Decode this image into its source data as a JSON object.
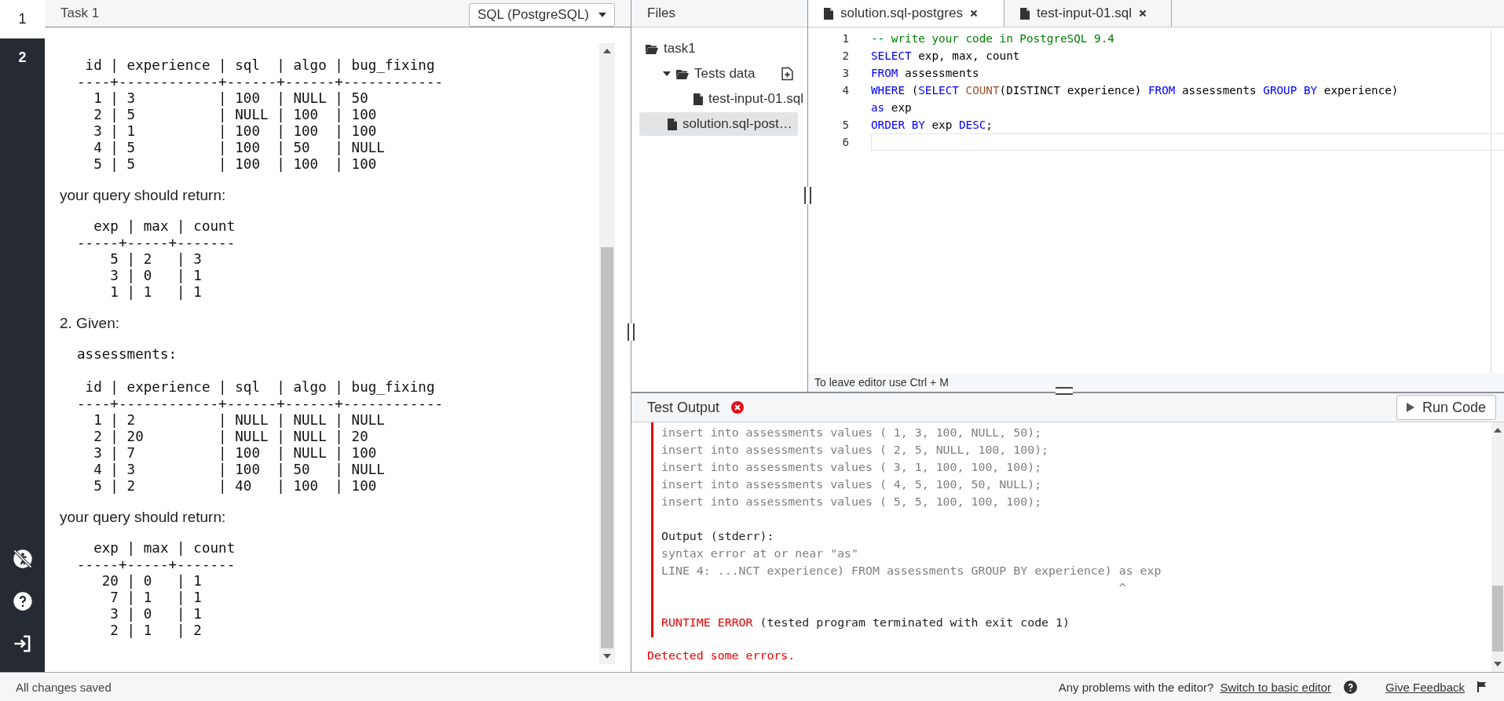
{
  "sidebar": {
    "tasks": [
      {
        "label": "1",
        "selected": true
      },
      {
        "label": "2",
        "selected": false
      }
    ]
  },
  "task_panel": {
    "title": "Task 1",
    "language": "SQL (PostgreSQL)",
    "blocks": [
      {
        "kind": "pre",
        "lines": [
          " id | experience | sql  | algo | bug_fixing",
          "----+------------+------+------+------------",
          "  1 | 3          | 100  | NULL | 50",
          "  2 | 5          | NULL | 100  | 100",
          "  3 | 1          | 100  | 100  | 100",
          "  4 | 5          | 100  | 50   | NULL",
          "  5 | 5          | 100  | 100  | 100"
        ]
      },
      {
        "kind": "text",
        "text": "your query should return:"
      },
      {
        "kind": "pre",
        "lines": [
          "  exp | max | count",
          "-----+-----+-------",
          "    5 | 2   | 3",
          "    3 | 0   | 1",
          "    1 | 1   | 1"
        ]
      },
      {
        "kind": "text",
        "text": "2. Given:"
      },
      {
        "kind": "pre",
        "lines": [
          "assessments:"
        ]
      },
      {
        "kind": "pre",
        "lines": [
          " id | experience | sql  | algo | bug_fixing",
          "----+------------+------+------+------------",
          "  1 | 2          | NULL | NULL | NULL",
          "  2 | 20         | NULL | NULL | 20",
          "  3 | 7          | 100  | NULL | 100",
          "  4 | 3          | 100  | 50   | NULL",
          "  5 | 2          | 40   | 100  | 100"
        ]
      },
      {
        "kind": "text",
        "text": "your query should return:"
      },
      {
        "kind": "pre",
        "lines": [
          "  exp | max | count",
          "-----+-----+-------",
          "   20 | 0   | 1",
          "    7 | 1   | 1",
          "    3 | 0   | 1",
          "    2 | 1   | 2"
        ]
      }
    ]
  },
  "files": {
    "title": "Files",
    "tree": [
      {
        "label": "task1",
        "kind": "folder",
        "expanded": true,
        "selected": false,
        "children": [
          {
            "label": "Tests data",
            "kind": "folder",
            "expanded": true,
            "selected": false,
            "children": [
              {
                "label": "test-input-01.sql",
                "kind": "file",
                "selected": false
              }
            ]
          },
          {
            "label": "solution.sql-post…",
            "kind": "file",
            "selected": true
          }
        ]
      }
    ]
  },
  "editor": {
    "tabs": [
      {
        "label": "solution.sql-postgres",
        "selected": true
      },
      {
        "label": "test-input-01.sql",
        "selected": false
      }
    ],
    "lines": [
      {
        "number": "1",
        "tokens": [
          {
            "kind": "comment",
            "text": "-- write your code in PostgreSQL 9.4"
          }
        ]
      },
      {
        "number": "2",
        "tokens": [
          {
            "kind": "keyword",
            "text": "SELECT"
          },
          {
            "kind": "plain",
            "text": " exp, max, count"
          }
        ]
      },
      {
        "number": "3",
        "tokens": [
          {
            "kind": "keyword",
            "text": "FROM"
          },
          {
            "kind": "plain",
            "text": " assessments"
          }
        ]
      },
      {
        "number": "4",
        "tokens": [
          {
            "kind": "keyword",
            "text": "WHERE"
          },
          {
            "kind": "plain",
            "text": " ("
          },
          {
            "kind": "keyword",
            "text": "SELECT"
          },
          {
            "kind": "function",
            "text": " COUNT"
          },
          {
            "kind": "plain",
            "text": "(DISTINCT experience) "
          },
          {
            "kind": "keyword",
            "text": "FROM"
          },
          {
            "kind": "plain",
            "text": " assessments "
          },
          {
            "kind": "keyword",
            "text": "GROUP BY"
          },
          {
            "kind": "plain",
            "text": " experience) "
          },
          {
            "kind": "keyword",
            "text": "as"
          },
          {
            "kind": "plain",
            "text": " exp"
          }
        ]
      },
      {
        "number": "5",
        "tokens": [
          {
            "kind": "keyword",
            "text": "ORDER BY"
          },
          {
            "kind": "plain",
            "text": " exp "
          },
          {
            "kind": "keyword",
            "text": "DESC"
          },
          {
            "kind": "plain",
            "text": ";"
          }
        ]
      },
      {
        "number": "6",
        "current": true
      }
    ],
    "hint": "To leave editor use Ctrl + M"
  },
  "test_output": {
    "title": "Test Output",
    "has_errors": true,
    "run_button": "Run Code",
    "lines": [
      {
        "kind": "muted",
        "text": "insert into assessments values ( 1, 3, 100, NULL, 50);"
      },
      {
        "kind": "muted",
        "text": "insert into assessments values ( 2, 5, NULL, 100, 100);"
      },
      {
        "kind": "muted",
        "text": "insert into assessments values ( 3, 1, 100, 100, 100);"
      },
      {
        "kind": "muted",
        "text": "insert into assessments values ( 4, 5, 100, 50, NULL);"
      },
      {
        "kind": "muted",
        "text": "insert into assessments values ( 5, 5, 100, 100, 100);"
      },
      {
        "kind": "heading",
        "text": "Output (stderr):"
      },
      {
        "kind": "muted",
        "text": "syntax error at or near \"as\""
      },
      {
        "kind": "muted",
        "text": "LINE 4: ...NCT experience) FROM assessments GROUP BY experience) as exp"
      },
      {
        "kind": "muted",
        "text": "                                                                 ^"
      },
      {
        "kind": "runtime",
        "label": "RUNTIME ERROR",
        "text": " (tested program terminated with exit code 1)"
      }
    ],
    "summary": "Detected some errors."
  },
  "status_bar": {
    "left": "All changes saved",
    "question": "Any problems with the editor?",
    "switch_link": "Switch to basic editor",
    "feedback_link": "Give Feedback"
  }
}
